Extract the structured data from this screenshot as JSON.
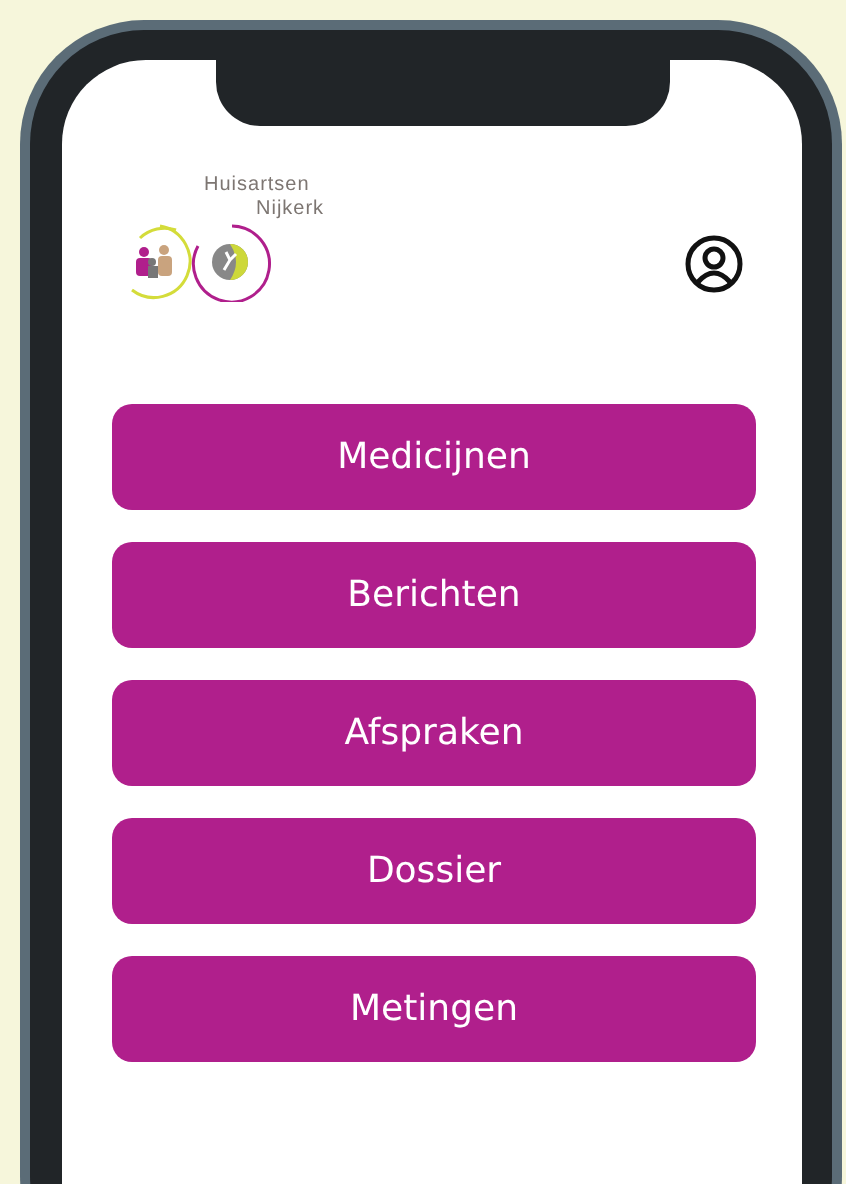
{
  "header": {
    "brand_lines": [
      "Huisartsen",
      "Nijkerk"
    ]
  },
  "menu": [
    {
      "label": "Medicijnen"
    },
    {
      "label": "Berichten"
    },
    {
      "label": "Afspraken"
    },
    {
      "label": "Dossier"
    },
    {
      "label": "Metingen"
    }
  ]
}
